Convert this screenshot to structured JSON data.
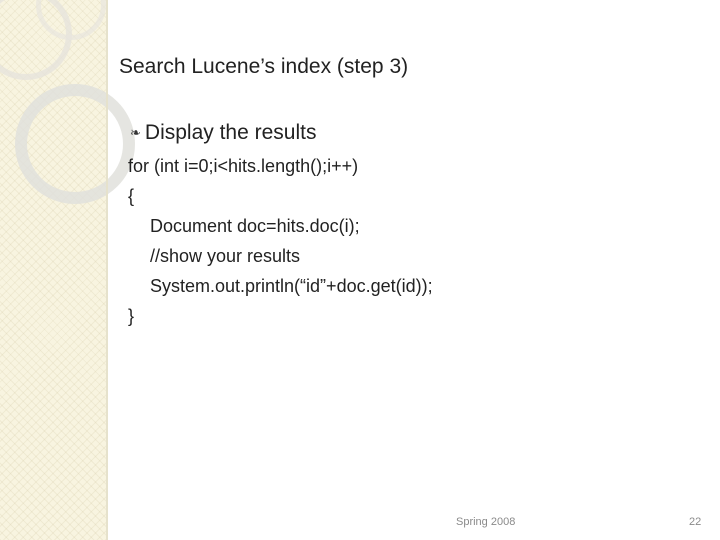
{
  "slide": {
    "title": "Search Lucene’s index (step 3)",
    "bullet": {
      "icon": "curl-bullet-icon",
      "text": "Display the results"
    },
    "code_lines": [
      "for (int i=0;i<hits.length();i++)",
      "{",
      "Document doc=hits.doc(i);",
      "//show your results",
      "System.out.println(“id”+doc.get(id));",
      "}"
    ]
  },
  "footer": {
    "date": "Spring 2008",
    "page_number": "22"
  },
  "colors": {
    "sidebar": "#f8f4e0",
    "text": "#222222",
    "footer_text": "#8a8a8a"
  }
}
